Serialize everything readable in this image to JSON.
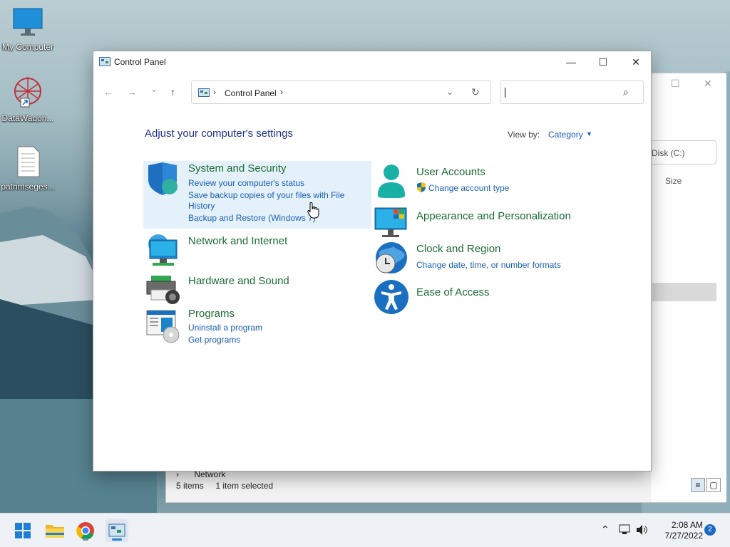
{
  "desktop": {
    "icons": [
      {
        "label": "My Computer"
      },
      {
        "label": "DataWagon..."
      },
      {
        "label": "pathmseges..."
      }
    ]
  },
  "bg_window": {
    "disk_label": "Disk (C:)",
    "size_header": "Size",
    "network_label": "Network",
    "item_count": "5 items",
    "selected_text": "1 item selected"
  },
  "window": {
    "title": "Control Panel",
    "minimize": "—",
    "maximize": "☐",
    "close": "✕"
  },
  "nav": {
    "back": "←",
    "forward": "→",
    "recent": "⌄",
    "up": "↑",
    "breadcrumb": "Control Panel",
    "separator": "›",
    "dropdown": "⌄",
    "refresh": "↻",
    "search_placeholder": "",
    "search_icon": "⌕"
  },
  "content": {
    "heading": "Adjust your computer's settings",
    "view_by_label": "View by:",
    "view_by_value": "Category",
    "view_by_arrow": "▼",
    "categories": {
      "system": {
        "title": "System and Security",
        "links": [
          "Review your computer's status",
          "Save backup copies of your files with File",
          "History",
          "Backup and Restore (Windows 7)"
        ]
      },
      "network": {
        "title": "Network and Internet"
      },
      "hardware": {
        "title": "Hardware and Sound"
      },
      "programs": {
        "title": "Programs",
        "links": [
          "Uninstall a program",
          "Get programs"
        ]
      },
      "user": {
        "title": "User Accounts",
        "links": [
          "Change account type"
        ]
      },
      "appearance": {
        "title": "Appearance and Personalization"
      },
      "clock": {
        "title": "Clock and Region",
        "links": [
          "Change date, time, or number formats"
        ]
      },
      "ease": {
        "title": "Ease of Access"
      }
    }
  },
  "taskbar": {
    "apps": [
      "start-icon",
      "file-explorer-icon",
      "chrome-icon",
      "control-panel-icon"
    ],
    "tray_chevron": "⌃",
    "time": "2:08 AM",
    "date": "7/27/2022",
    "notification_count": "2"
  },
  "colors": {
    "category_title": "#1c6b34",
    "link": "#1a5fb4",
    "heading": "#1e3287",
    "highlight": "#e4f1fb"
  }
}
